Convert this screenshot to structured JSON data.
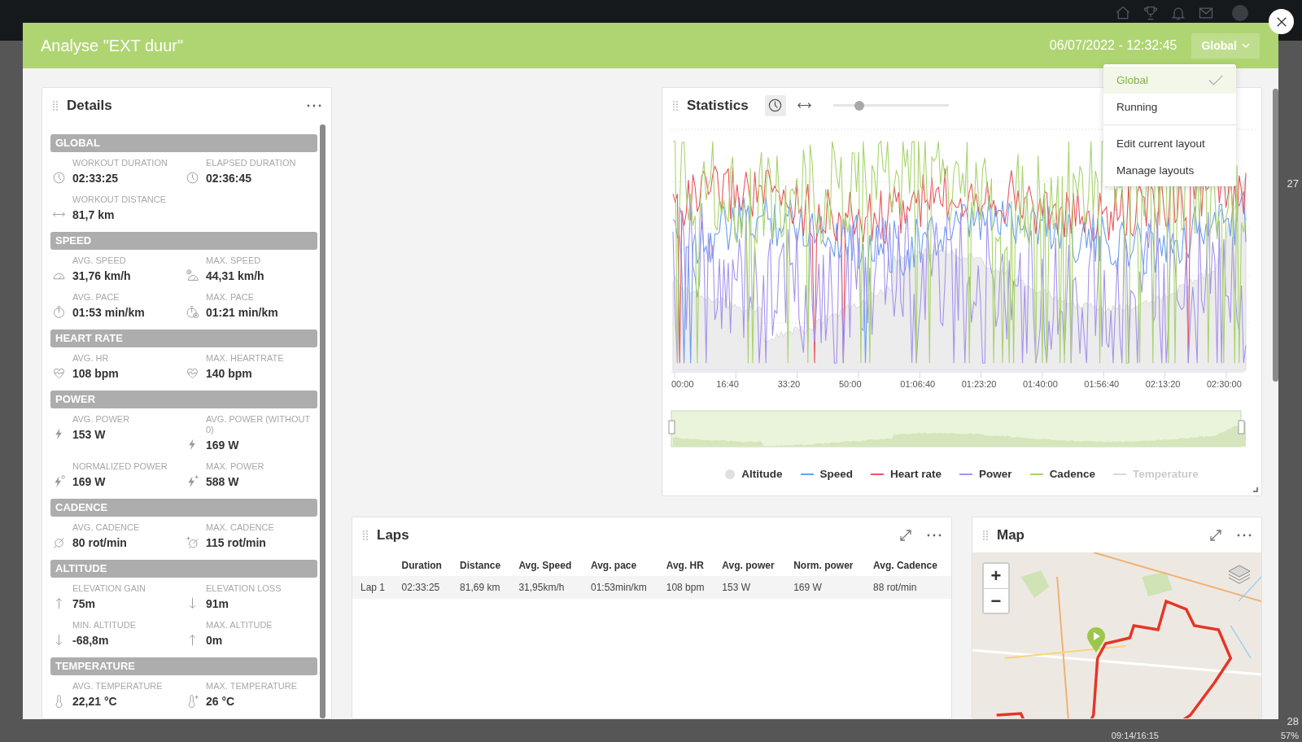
{
  "background": {
    "side_numbers": [
      "27",
      "28"
    ],
    "footer_time": "09:14/16:15",
    "footer_percent": "57%"
  },
  "window": {
    "title": "Analyse \"EXT duur\"",
    "datetime": "06/07/2022 - 12:32:45",
    "layout_button": "Global"
  },
  "layout_menu": {
    "layouts": [
      {
        "label": "Global",
        "selected": true
      },
      {
        "label": "Running",
        "selected": false
      }
    ],
    "actions": [
      "Edit current layout",
      "Manage layouts"
    ]
  },
  "details": {
    "title": "Details",
    "sections": [
      {
        "title": "GLOBAL",
        "items": [
          {
            "label": "WORKOUT DURATION",
            "value": "02:33:25",
            "kind": "clock"
          },
          {
            "label": "ELAPSED DURATION",
            "value": "02:36:45",
            "kind": "clock"
          },
          {
            "label": "WORKOUT DISTANCE",
            "value": "81,7 km",
            "kind": "distance"
          }
        ]
      },
      {
        "title": "SPEED",
        "items": [
          {
            "label": "AVG. SPEED",
            "value": "31,76 km/h",
            "kind": "gauge"
          },
          {
            "label": "MAX. SPEED",
            "value": "44,31 km/h",
            "kind": "gaugeplus"
          },
          {
            "label": "AVG. PACE",
            "value": "01:53 min/km",
            "kind": "stopwatch"
          },
          {
            "label": "MAX. PACE",
            "value": "01:21 min/km",
            "kind": "stopwatchplus"
          }
        ]
      },
      {
        "title": "HEART RATE",
        "items": [
          {
            "label": "AVG. HR",
            "value": "108 bpm",
            "kind": "heart"
          },
          {
            "label": "MAX. HEARTRATE",
            "value": "140 bpm",
            "kind": "heart"
          }
        ]
      },
      {
        "title": "POWER",
        "items": [
          {
            "label": "AVG. POWER",
            "value": "153 W",
            "kind": "bolt"
          },
          {
            "label": "AVG. POWER (WITHOUT 0)",
            "value": "169 W",
            "kind": "bolt"
          },
          {
            "label": "NORMALIZED POWER",
            "value": "169 W",
            "kind": "boltring"
          },
          {
            "label": "MAX. POWER",
            "value": "588 W",
            "kind": "boltplus"
          }
        ]
      },
      {
        "title": "CADENCE",
        "items": [
          {
            "label": "AVG. CADENCE",
            "value": "80 rot/min",
            "kind": "cadence"
          },
          {
            "label": "MAX. CADENCE",
            "value": "115 rot/min",
            "kind": "cadenceplus"
          }
        ]
      },
      {
        "title": "ALTITUDE",
        "items": [
          {
            "label": "ELEVATION GAIN",
            "value": "75m",
            "kind": "up"
          },
          {
            "label": "ELEVATION LOSS",
            "value": "91m",
            "kind": "down"
          },
          {
            "label": "MIN. ALTITUDE",
            "value": "-68,8m",
            "kind": "down"
          },
          {
            "label": "MAX. ALTITUDE",
            "value": "0m",
            "kind": "up"
          }
        ]
      },
      {
        "title": "TEMPERATURE",
        "items": [
          {
            "label": "AVG. TEMPERATURE",
            "value": "22,21 °C",
            "kind": "thermo"
          },
          {
            "label": "MAX. TEMPERATURE",
            "value": "26 °C",
            "kind": "thermoplus"
          }
        ]
      }
    ]
  },
  "statistics": {
    "title": "Statistics",
    "axis_modes": [
      {
        "kind": "time",
        "selected": true
      },
      {
        "kind": "distance",
        "selected": false
      }
    ],
    "zoom_slider": {
      "level": 0.23
    },
    "x_ticks": [
      "00:00",
      "16:40",
      "33:20",
      "50:00",
      "01:06:40",
      "01:23:20",
      "01:40:00",
      "01:56:40",
      "02:13:20",
      "02:30:00"
    ],
    "legend": [
      {
        "name": "Altitude",
        "kind": "area",
        "color": "#e0e0e0",
        "disabled": false
      },
      {
        "name": "Speed",
        "kind": "line",
        "color": "#6a9ff0",
        "disabled": false
      },
      {
        "name": "Heart rate",
        "kind": "line",
        "color": "#e8555e",
        "disabled": false
      },
      {
        "name": "Power",
        "kind": "line",
        "color": "#a593ee",
        "disabled": false
      },
      {
        "name": "Cadence",
        "kind": "line",
        "color": "#a8d46e",
        "disabled": false
      },
      {
        "name": "Temperature",
        "kind": "line",
        "color": "#d8d8d8",
        "disabled": true
      }
    ]
  },
  "laps": {
    "title": "Laps",
    "columns": [
      "",
      "Duration",
      "Distance",
      "Avg. Speed",
      "Avg. pace",
      "Avg. HR",
      "Avg. power",
      "Norm. power",
      "Avg. Cadence"
    ],
    "rows": [
      {
        "cells": [
          "Lap 1",
          "02:33:25",
          "81,69 km",
          "31,95km/h",
          "01:53min/km",
          "108 bpm",
          "153 W",
          "169 W",
          "88 rot/min"
        ]
      }
    ]
  },
  "map": {
    "title": "Map",
    "zoom_in": "+",
    "zoom_out": "−"
  }
}
